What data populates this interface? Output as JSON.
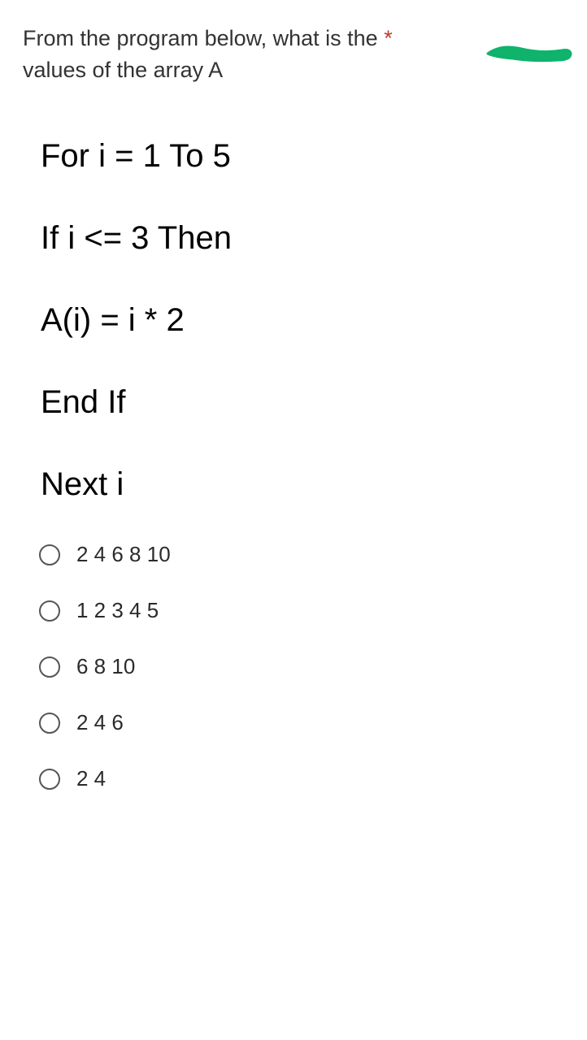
{
  "question": {
    "line1": "From the program below, what is the ",
    "asterisk": "*",
    "line2": "values of the array A"
  },
  "code": {
    "l1": "For i = 1 To 5",
    "l2": "If i <= 3 Then",
    "l3": "A(i) = i * 2",
    "l4": "End If",
    "l5": "Next i"
  },
  "options": [
    {
      "label": "2 4 6 8 10"
    },
    {
      "label": "1 2 3 4 5"
    },
    {
      "label": "6 8 10"
    },
    {
      "label": "2 4 6"
    },
    {
      "label": "2 4"
    }
  ]
}
